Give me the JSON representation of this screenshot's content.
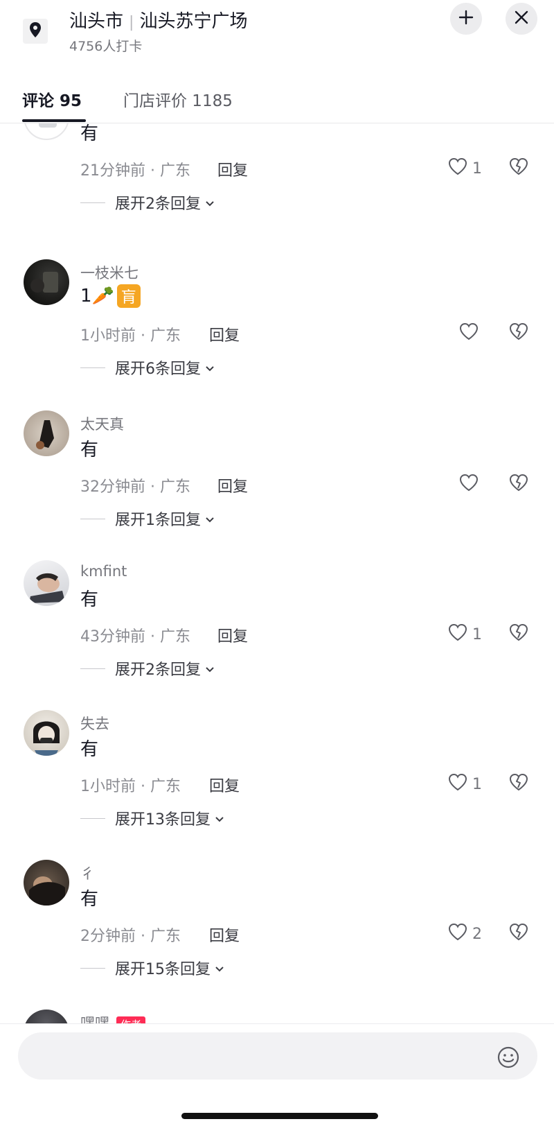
{
  "header": {
    "city": "汕头市",
    "place": "汕头苏宁广场",
    "checkins": "4756人打卡"
  },
  "tabs": [
    {
      "label": "评论 95",
      "active": true
    },
    {
      "label": "门店评价 1185",
      "active": false
    }
  ],
  "comments": [
    {
      "username": "",
      "text": "有",
      "meta": "21分钟前 · 广东",
      "reply": "回复",
      "likes": "1",
      "expand": "展开2条回复"
    },
    {
      "username": "一枝米七",
      "text": "1🥕",
      "emoji_badge": "肓",
      "meta": "1小时前 · 广东",
      "reply": "回复",
      "likes": "",
      "expand": "展开6条回复"
    },
    {
      "username": "太天真",
      "text": "有",
      "meta": "32分钟前 · 广东",
      "reply": "回复",
      "likes": "",
      "expand": "展开1条回复"
    },
    {
      "username": "kmfint",
      "text": "有",
      "meta": "43分钟前 · 广东",
      "reply": "回复",
      "likes": "1",
      "expand": "展开2条回复"
    },
    {
      "username": "失去",
      "text": "有",
      "meta": "1小时前 · 广东",
      "reply": "回复",
      "likes": "1",
      "expand": "展开13条回复"
    },
    {
      "username": "彳",
      "text": "有",
      "meta": "2分钟前 · 广东",
      "reply": "回复",
      "likes": "2",
      "expand": "展开15条回复"
    },
    {
      "username": "嘿嘿",
      "badge": "作者",
      "text": "",
      "meta": "",
      "reply": "",
      "likes": "",
      "expand": ""
    }
  ],
  "input": {
    "placeholder": ""
  },
  "icons": {
    "location": "location-pin-icon",
    "add": "plus-icon",
    "close": "close-icon",
    "like": "heart-icon",
    "dislike": "broken-heart-icon",
    "expand": "chevron-down-icon",
    "emoji": "emoji-icon"
  },
  "colors": {
    "text": "#161823",
    "muted": "#8a8b91",
    "accent_badge": "#fe2c55",
    "emoji_box": "#f5a623"
  }
}
